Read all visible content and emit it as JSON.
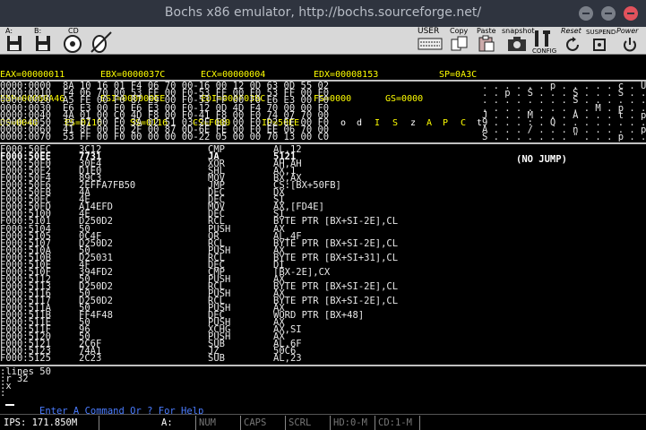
{
  "window": {
    "title": "Bochs x86 emulator, http://bochs.sourceforge.net/"
  },
  "toolbar": {
    "floppy_a": "A:",
    "floppy_b": "B:",
    "cdrom": "CD",
    "user": "USER",
    "copy": "Copy",
    "paste": "Paste",
    "snapshot": "snapshot",
    "config": "CONFIG",
    "reset": "Reset",
    "suspend": "SUSPEND",
    "power": "Power"
  },
  "registers": {
    "eax": "EAX=00000011",
    "ebx": "EBX=0000037C",
    "ecx": "ECX=00000004",
    "edx": "EDX=00008153",
    "sp": "SP=0A3C",
    "ebp": "EBP=00000A46",
    "esi": "ESI=000000EE",
    "edi": "EDI=000F03BC",
    "fs": "FS=0000",
    "gs": "GS=0000",
    "ds": "DS=0040",
    "es": "ES=0116",
    "ss": "SS=0116",
    "cs": "CS=F000",
    "ip": "IP=50EE",
    "flags": [
      "o",
      "d",
      "I",
      "S",
      "z",
      "A",
      "P",
      "C",
      "t"
    ]
  },
  "hexdump": [
    {
      "addr": "0000:0000",
      "bytes": "8A 10 16 01 F4 06 70 00-16 00 12 0D 63 0D 55 02",
      "ascii": ". . . . . . p . . . . . c . U ."
    },
    {
      "addr": "0000:0010",
      "bytes": "F4 06 70 00 53 FF 00 F0-53 FF 00 F0 53 FF 00 F0",
      "ascii": ". . p . S . . . S . . . S . . ."
    },
    {
      "addr": "0000:0020",
      "bytes": "A5 FE 00 F0 87 E9 00 F0-53 FF 00 F0 E6 E3 00 F0",
      "ascii": ". . . . . . . . S . . . . . . ."
    },
    {
      "addr": "0000:0030",
      "bytes": "E6 E3 00 F0 E6 E3 00 F0-12 0D 4D F4 70 00 00 F0",
      "ascii": ". . . . . . . . . . M . p . . ."
    },
    {
      "addr": "0000:0040",
      "bytes": "4A 01 00 C0 4D F8 00 F0-41 F8 00 F0 74 07 70 00",
      "ascii": "J . . . M . . . A . . . t . p ."
    },
    {
      "addr": "0000:0050",
      "bytes": "39 E7 00 F0 3A 02 51 03-2E E8 00 F0 D2 EF 00 F0",
      "ascii": "9 . . . : . Q . . . . . . . . ."
    },
    {
      "addr": "0000:0060",
      "bytes": "41 8F 00 F0 2F 00 87 0D-6E FE 00 F0 EE 06 70 00",
      "ascii": "A . . . / . . . n . . . . . p ."
    },
    {
      "addr": "0000:0070",
      "bytes": "53 FF 00 F0 00 00 00 00-22 05 00 00 70 13 00 C0",
      "ascii": "S . . . . . . . \" . . . p . . ."
    }
  ],
  "disasm": [
    {
      "addr": "F000:50EC",
      "bytes": "3C12",
      "mnem": "CMP",
      "ops": "AL,12"
    },
    {
      "addr": "F000:50EE",
      "bytes": "7731",
      "mnem": "JA",
      "ops": "5121"
    },
    {
      "addr": "F000:50F0",
      "bytes": "30E4",
      "mnem": "XOR",
      "ops": "AH,AH"
    },
    {
      "addr": "F000:50F2",
      "bytes": "D1E0",
      "mnem": "SHL",
      "ops": "AX,1"
    },
    {
      "addr": "F000:50F4",
      "bytes": "89C3",
      "mnem": "MOV",
      "ops": "BX,AX"
    },
    {
      "addr": "F000:50F6",
      "bytes": "2EFFA7FB50",
      "mnem": "JMP",
      "ops": "CS:[BX+50FB]"
    },
    {
      "addr": "F000:50FB",
      "bytes": "4A",
      "mnem": "DEC",
      "ops": "DX"
    },
    {
      "addr": "F000:50FC",
      "bytes": "4E",
      "mnem": "DEC",
      "ops": "SI"
    },
    {
      "addr": "F000:50FD",
      "bytes": "A14EFD",
      "mnem": "MOV",
      "ops": "AX,[FD4E]"
    },
    {
      "addr": "F000:5100",
      "bytes": "4E",
      "mnem": "DEC",
      "ops": "SI"
    },
    {
      "addr": "F000:5101",
      "bytes": "D250D2",
      "mnem": "RCL",
      "ops": "BYTE PTR [BX+SI-2E],CL"
    },
    {
      "addr": "F000:5104",
      "bytes": "50",
      "mnem": "PUSH",
      "ops": "AX"
    },
    {
      "addr": "F000:5105",
      "bytes": "0C4F",
      "mnem": "OR",
      "ops": "AL,4F"
    },
    {
      "addr": "F000:5107",
      "bytes": "D250D2",
      "mnem": "RCL",
      "ops": "BYTE PTR [BX+SI-2E],CL"
    },
    {
      "addr": "F000:510A",
      "bytes": "50",
      "mnem": "PUSH",
      "ops": "AX"
    },
    {
      "addr": "F000:510B",
      "bytes": "D25031",
      "mnem": "RCL",
      "ops": "BYTE PTR [BX+SI+31],CL"
    },
    {
      "addr": "F000:510E",
      "bytes": "4F",
      "mnem": "DEC",
      "ops": "DI"
    },
    {
      "addr": "F000:510F",
      "bytes": "394FD2",
      "mnem": "CMP",
      "ops": "[BX-2E],CX"
    },
    {
      "addr": "F000:5112",
      "bytes": "50",
      "mnem": "PUSH",
      "ops": "AX"
    },
    {
      "addr": "F000:5113",
      "bytes": "D250D2",
      "mnem": "RCL",
      "ops": "BYTE PTR [BX+SI-2E],CL"
    },
    {
      "addr": "F000:5116",
      "bytes": "50",
      "mnem": "PUSH",
      "ops": "AX"
    },
    {
      "addr": "F000:5117",
      "bytes": "D250D2",
      "mnem": "RCL",
      "ops": "BYTE PTR [BX+SI-2E],CL"
    },
    {
      "addr": "F000:511A",
      "bytes": "50",
      "mnem": "PUSH",
      "ops": "AX"
    },
    {
      "addr": "F000:511B",
      "bytes": "FF4F48",
      "mnem": "DEC",
      "ops": "WORD PTR [BX+48]"
    },
    {
      "addr": "F000:511E",
      "bytes": "50",
      "mnem": "PUSH",
      "ops": "AX"
    },
    {
      "addr": "F000:511F",
      "bytes": "96",
      "mnem": "XCHG",
      "ops": "AX,SI"
    },
    {
      "addr": "F000:5120",
      "bytes": "50",
      "mnem": "PUSH",
      "ops": "AX"
    },
    {
      "addr": "F000:5121",
      "bytes": "2C6F",
      "mnem": "SUB",
      "ops": "AL,6F"
    },
    {
      "addr": "F000:5123",
      "bytes": "74A1",
      "mnem": "JZ",
      "ops": "50C6"
    },
    {
      "addr": "F000:5125",
      "bytes": "2C23",
      "mnem": "SUB",
      "ops": "AL,23"
    }
  ],
  "jump_status": "(NO JUMP)",
  "console": {
    "lines": [
      ":lines 50",
      ":r 32",
      ":x",
      ":"
    ],
    "prompt": "Enter A Command Or ? For Help"
  },
  "status": {
    "ips": "IPS: 171.850M",
    "drive": "A:",
    "num": "NUM",
    "caps": "CAPS",
    "scrl": "SCRL",
    "hd": "HD:0-M",
    "cd": "CD:1-M"
  }
}
